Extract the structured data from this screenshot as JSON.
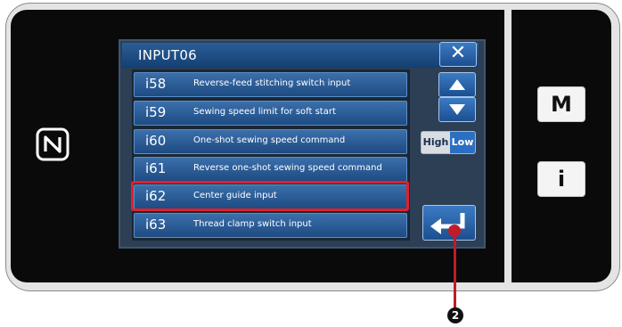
{
  "dialog": {
    "title": "INPUT06",
    "close_label": "✕"
  },
  "rows": [
    {
      "code": "i58",
      "name": "Reverse-feed stitching switch input"
    },
    {
      "code": "i59",
      "name": "Sewing speed limit for soft start"
    },
    {
      "code": "i60",
      "name": "One-shot sewing speed command"
    },
    {
      "code": "i61",
      "name": "Reverse one-shot sewing speed command"
    },
    {
      "code": "i62",
      "name": "Center guide input"
    },
    {
      "code": "i63",
      "name": "Thread clamp switch input"
    }
  ],
  "toggle": {
    "high_label": "High",
    "low_label": "Low",
    "selected": "Low"
  },
  "side_buttons": {
    "menu_label": "M",
    "info_label": "i"
  },
  "callout": {
    "number": "2"
  },
  "icons": {
    "nfc": "nfc-icon",
    "up": "arrow-up-icon",
    "down": "arrow-down-icon",
    "enter": "enter-icon",
    "close": "close-icon"
  },
  "colors": {
    "title_bar": "#1e4e86",
    "row": "#2a5c98",
    "highlight": "#e0202e",
    "low_selected": "#2c6fc2",
    "callout": "#c01c28"
  }
}
